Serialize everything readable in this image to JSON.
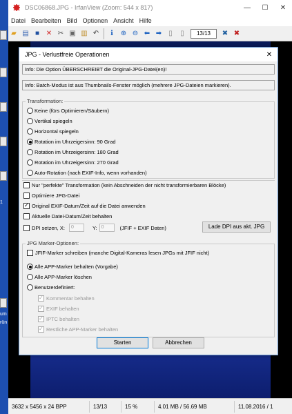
{
  "window": {
    "title": "DSC06868.JPG - IrfanView (Zoom: 544 x 817)",
    "minimize": "—",
    "maximize": "☐",
    "close": "✕"
  },
  "menu": [
    "Datei",
    "Bearbeiten",
    "Bild",
    "Optionen",
    "Ansicht",
    "Hilfe"
  ],
  "toolbar": {
    "page": "13/13"
  },
  "desktop": {
    "text1": "1",
    "text2": "um",
    "text3": "rün"
  },
  "status": {
    "dims": "3632 x 5456 x 24 BPP",
    "index": "13/13",
    "zoom": "15 %",
    "size": "4.01 MB / 56.69 MB",
    "date": "11.08.2016 / 1"
  },
  "dialog": {
    "title": "JPG - Verlustfreie Operationen",
    "close": "✕",
    "info1": "Info: Die Option ÜBERSCHREIBT die Original-JPG-Datei(en)!",
    "info2": "Info: Batch-Modus ist aus Thumbnails-Fenster möglich (mehrere JPG-Dateien markieren).",
    "transform_label": "Transformation:",
    "transforms": [
      "Keine (fürs Optimieren/Säubern)",
      "Vertikal spiegeln",
      "Horizontal spiegeln",
      "Rotation im Uhrzeigersinn: 90 Grad",
      "Rotation im Uhrzeigersinn: 180 Grad",
      "Rotation im Uhrzeigersinn: 270 Grad",
      "Auto-Rotation (nach EXIF-Info, wenn vorhanden)"
    ],
    "transform_selected": 3,
    "checks": [
      {
        "label": "Nur \"perfekte\" Transformation (kein Abschneiden der nicht transformierbaren Blöcke)",
        "checked": false
      },
      {
        "label": "Optimiere JPG-Datei",
        "checked": false
      },
      {
        "label": "Original EXIF-Datum/Zeit auf die Datei anwenden",
        "checked": true
      },
      {
        "label": "Aktuelle Datei-Datum/Zeit behalten",
        "checked": false
      }
    ],
    "dpi": {
      "label": "DPI setzen, X:",
      "x": "0",
      "y_label": "Y:",
      "y": "0",
      "note": "(JFIF + EXIF Daten)",
      "button": "Lade DPI aus akt. JPG"
    },
    "marker_label": "JPG Marker-Optionen:",
    "jfif_check": "JFIF-Marker schreiben (manche Digital-Kameras lesen JPGs mit JFIF nicht)",
    "marker_opts": [
      "Alle APP-Marker behalten (Vorgabe)",
      "Alle APP-Marker löschen",
      "Benutzerdefiniert:"
    ],
    "marker_selected": 0,
    "custom": [
      "Kommentar behalten",
      "EXIF behalten",
      "IPTC behalten",
      "Restliche APP-Marker behalten"
    ],
    "start": "Starten",
    "cancel": "Abbrechen"
  }
}
